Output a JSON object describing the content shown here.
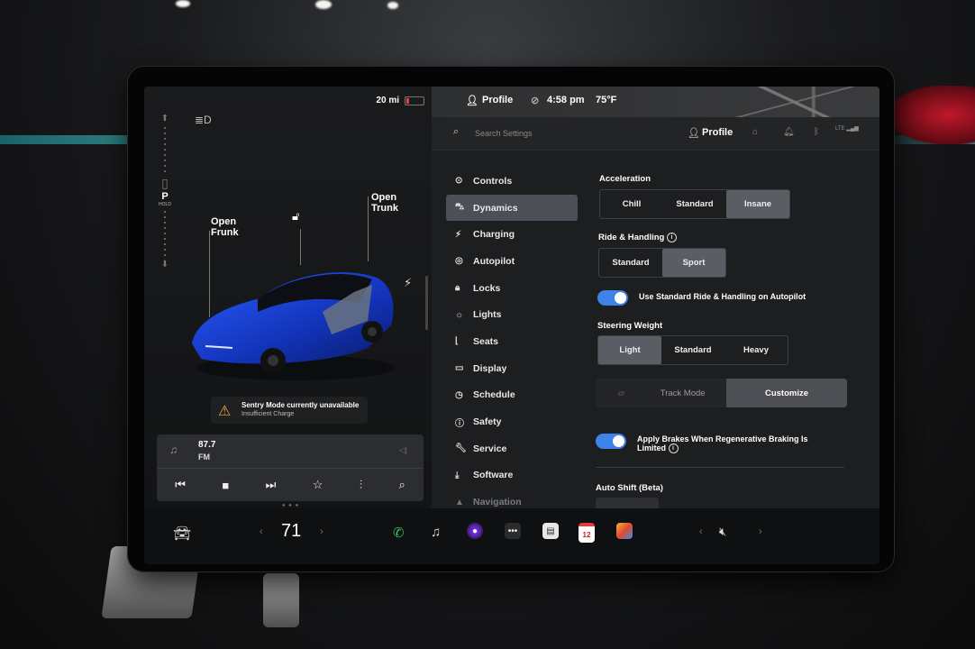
{
  "left_panel": {
    "range": "20 mi",
    "gear": "P",
    "gear_hold": "HOLD",
    "frunk_label": [
      "Open",
      "Frunk"
    ],
    "trunk_label": [
      "Open",
      "Trunk"
    ],
    "sentry_title": "Sentry Mode currently unavailable",
    "sentry_sub": "Insufficient Charge",
    "media": {
      "frequency": "87.7",
      "band": "FM"
    }
  },
  "topbar": {
    "profile": "Profile",
    "time": "4:58 pm",
    "temperature": "75°F"
  },
  "search": {
    "placeholder": "Search Settings",
    "profile": "Profile",
    "lte": "LTE"
  },
  "menu": [
    {
      "label": "Controls",
      "icon": "toggle-icon"
    },
    {
      "label": "Dynamics",
      "icon": "car-icon",
      "active": true
    },
    {
      "label": "Charging",
      "icon": "bolt-icon"
    },
    {
      "label": "Autopilot",
      "icon": "steering-icon"
    },
    {
      "label": "Locks",
      "icon": "lock-icon"
    },
    {
      "label": "Lights",
      "icon": "sun-icon"
    },
    {
      "label": "Seats",
      "icon": "seat-icon"
    },
    {
      "label": "Display",
      "icon": "display-icon"
    },
    {
      "label": "Schedule",
      "icon": "clock-icon"
    },
    {
      "label": "Safety",
      "icon": "info-icon"
    },
    {
      "label": "Service",
      "icon": "wrench-icon"
    },
    {
      "label": "Software",
      "icon": "download-icon"
    },
    {
      "label": "Navigation",
      "icon": "nav-icon"
    }
  ],
  "dynamics": {
    "acceleration": {
      "title": "Acceleration",
      "options": [
        "Chill",
        "Standard",
        "Insane"
      ],
      "selected": "Insane"
    },
    "ride": {
      "title": "Ride & Handling",
      "options": [
        "Standard",
        "Sport"
      ],
      "selected": "Sport"
    },
    "ride_toggle_label": "Use Standard Ride & Handling on Autopilot",
    "steering": {
      "title": "Steering Weight",
      "options": [
        "Light",
        "Standard",
        "Heavy"
      ],
      "selected": "Light"
    },
    "track_mode": "Track Mode",
    "customize": "Customize",
    "regen_label": "Apply Brakes When Regenerative Braking Is Limited",
    "auto_shift": "Auto Shift (Beta)"
  },
  "dock": {
    "temperature": "71",
    "calendar_day": "12"
  }
}
